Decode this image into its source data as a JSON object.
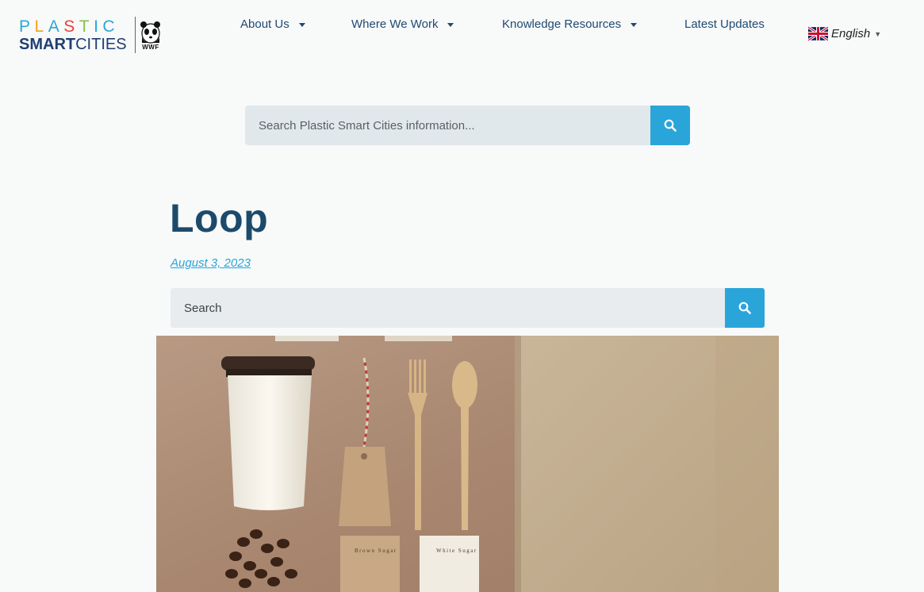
{
  "brand": {
    "logo_line1_letters": [
      "P",
      "L",
      "A",
      "S",
      "T",
      "I",
      "C"
    ],
    "logo_line2_bold": "SMART",
    "logo_line2_regular": "CITIES",
    "partner_label": "WWF"
  },
  "nav": {
    "items": [
      {
        "label": "About Us",
        "has_dropdown": true
      },
      {
        "label": "Where We Work",
        "has_dropdown": true
      },
      {
        "label": "Knowledge Resources",
        "has_dropdown": true
      },
      {
        "label": "Latest Updates",
        "has_dropdown": false
      }
    ]
  },
  "language": {
    "selected": "English",
    "flag_icon": "uk-flag-icon"
  },
  "top_search": {
    "placeholder": "Search Plastic Smart Cities information...",
    "button_icon": "search-icon",
    "button_color": "#2aa5da"
  },
  "post": {
    "title": "Loop",
    "date": "August 3, 2023"
  },
  "post_search": {
    "placeholder": "Search",
    "button_icon": "search-icon"
  },
  "colors": {
    "title": "#1c4a6b",
    "nav_text": "#1e4a73",
    "accent": "#2aa5da",
    "background": "#f8f9f9"
  },
  "hero_image": {
    "description_icon": "eco-packaging-photo",
    "labels": [
      "Brown Sugar",
      "White Sugar"
    ]
  }
}
